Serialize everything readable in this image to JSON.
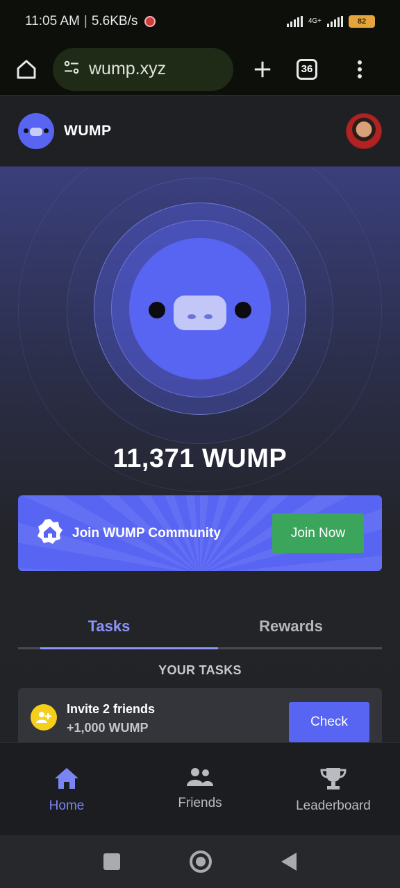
{
  "status_bar": {
    "time": "11:05 AM",
    "net_speed": "5.6KB/s",
    "network_type": "4G+",
    "battery_level": "82"
  },
  "browser": {
    "url": "wump.xyz",
    "tab_count": "36",
    "icons": [
      "home-icon",
      "site-settings-icon",
      "new-tab-plus-icon",
      "tab-switcher-icon",
      "overflow-menu-icon"
    ]
  },
  "app": {
    "brand": "WUMP",
    "balance": "11,371 WUMP",
    "join_card": {
      "text": "Join WUMP Community",
      "button": "Join Now"
    },
    "tabs": [
      {
        "label": "Tasks",
        "active": true
      },
      {
        "label": "Rewards",
        "active": false
      }
    ],
    "tasks_heading": "YOUR TASKS",
    "tasks": [
      {
        "title": "Invite 2 friends",
        "reward": "+1,000 WUMP",
        "button": "Check"
      }
    ],
    "bottom_nav": [
      {
        "label": "Home",
        "icon": "home-icon",
        "active": true
      },
      {
        "label": "Friends",
        "icon": "friends-icon",
        "active": false
      },
      {
        "label": "Leaderboard",
        "icon": "trophy-icon",
        "active": false
      }
    ]
  },
  "colors": {
    "accent": "#5865f2",
    "success": "#3ba55c",
    "active_tab": "#8c93f7",
    "task_icon": "#f4cf1c"
  }
}
